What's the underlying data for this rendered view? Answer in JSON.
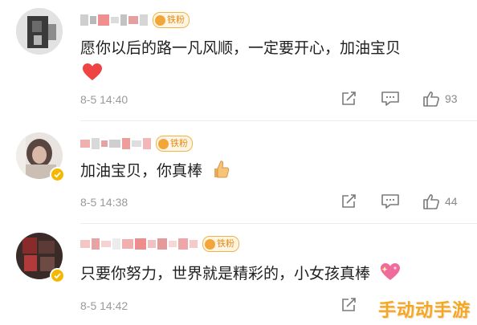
{
  "fan_badge_label": "铁粉",
  "comments": [
    {
      "text": "愿你以后的路一凡风顺，一定要开心，加油宝贝",
      "emoji": "red-heart",
      "time": "8-5 14:40",
      "likes": "93"
    },
    {
      "text": "加油宝贝，你真棒",
      "emoji": "thumbs-up",
      "time": "8-5 14:38",
      "likes": "44"
    },
    {
      "text": "只要你努力，世界就是精彩的，小女孩真棒",
      "emoji": "sparkling-heart",
      "time": "8-5 14:42",
      "likes": ""
    }
  ],
  "watermark": "手动动手游",
  "colors": {
    "badge_orange": "#f2a63a",
    "verified_gold": "#f5b800",
    "heart_red": "#ef4444",
    "watermark_orange": "#f5a623"
  }
}
